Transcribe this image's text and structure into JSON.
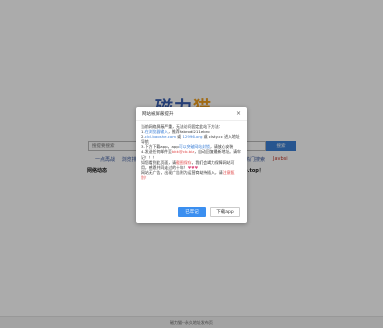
{
  "page": {
    "logo_main": "磁力",
    "logo_accent": "猫",
    "search_placeholder": "搜提要搜索",
    "search_button": "搜索",
    "links": [
      "一点再战",
      "浏览排行",
      "",
      ""
    ],
    "link_right": "热门搜索",
    "link_red": "Javbsi",
    "notice_start": "网络动态",
    "notice_end": "p.top！",
    "footer": "磁力猫--永久地址发布页"
  },
  "modal": {
    "title": "网站被屏蔽提升",
    "close": "×",
    "lines": [
      {
        "parts": [
          {
            "t": "当前网络屏蔽严重，无法访问固定此站下方法："
          }
        ]
      },
      {
        "parts": [
          {
            "t": "1."
          },
          {
            "t": "在浏览器输入",
            "c": "blue"
          },
          {
            "t": "，推荐fabrodi211ebro"
          }
        ]
      },
      {
        "parts": [
          {
            "t": "2."
          },
          {
            "t": "clcl.baoshe.com",
            "c": "blue"
          },
          {
            "t": " 或 "
          },
          {
            "t": "12996.org",
            "c": "blue"
          },
          {
            "t": " 或 clsty.cc 进入地址导航"
          }
        ]
      },
      {
        "parts": [
          {
            "t": "3.下方下载app，app"
          },
          {
            "t": "可以突破网站封锁",
            "c": "blue"
          },
          {
            "t": "，请放心安装"
          }
        ]
      },
      {
        "parts": [
          {
            "t": "4.发送任何邮件至"
          },
          {
            "t": "bkk@cb.biz",
            "c": "red-t"
          },
          {
            "t": "，自动回复最新地址。请牢记！！！"
          }
        ]
      },
      {
        "parts": [
          {
            "t": "如您看到此页面，请"
          },
          {
            "t": "截图保存",
            "c": "red-t"
          },
          {
            "t": "，我们会竭力保障网站可用，感恩共同走过的十年！"
          },
          {
            "t": "♥♥♥",
            "c": "pink"
          }
        ]
      },
      {
        "parts": [
          {
            "t": "网站无广告，出现广告则为运营商劫持插入，请"
          },
          {
            "t": "注意甄别！",
            "c": "red-t"
          }
        ]
      }
    ],
    "btn_primary": "已牢记",
    "btn_secondary": "下载app"
  }
}
